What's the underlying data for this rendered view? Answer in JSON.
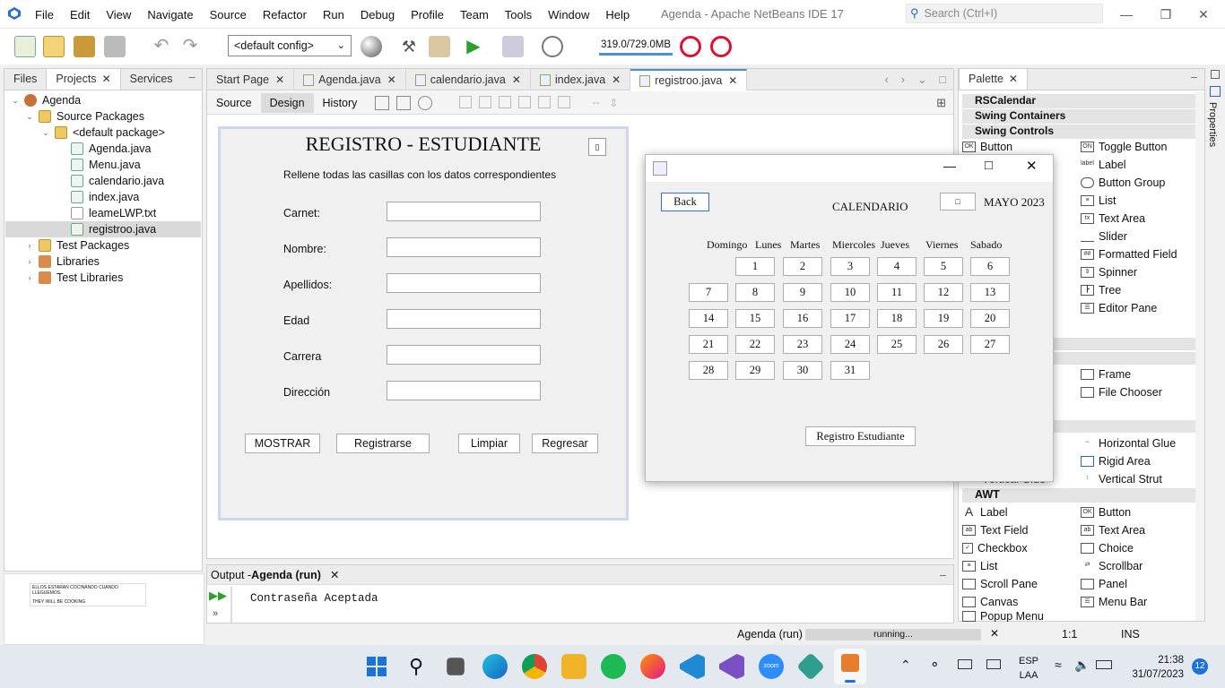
{
  "window": {
    "title": "Agenda - Apache NetBeans IDE 17"
  },
  "menu": [
    "File",
    "Edit",
    "View",
    "Navigate",
    "Source",
    "Refactor",
    "Run",
    "Debug",
    "Profile",
    "Team",
    "Tools",
    "Window",
    "Help"
  ],
  "search": {
    "placeholder": "Search (Ctrl+I)"
  },
  "toolbar": {
    "config": "<default config>",
    "memory": "319.0/729.0MB"
  },
  "left_panel": {
    "tabs": [
      {
        "label": "Files"
      },
      {
        "label": "Projects"
      },
      {
        "label": "Services"
      }
    ],
    "tree": [
      {
        "label": "Agenda"
      },
      {
        "label": "Source Packages"
      },
      {
        "label": "<default package>"
      },
      {
        "label": "Agenda.java"
      },
      {
        "label": "Menu.java"
      },
      {
        "label": "calendario.java"
      },
      {
        "label": "index.java"
      },
      {
        "label": "leameLWP.txt"
      },
      {
        "label": "registroo.java"
      },
      {
        "label": "Test Packages"
      },
      {
        "label": "Libraries"
      },
      {
        "label": "Test Libraries"
      }
    ]
  },
  "thumbnail": {
    "line1": "ELLOS ESTARAN COCINANDO CUANDO",
    "line2": "LLEGUEMOS.",
    "line3": "THEY WILL BE COOKING"
  },
  "editor": {
    "tabs": [
      {
        "label": "Start Page"
      },
      {
        "label": "Agenda.java"
      },
      {
        "label": "calendario.java"
      },
      {
        "label": "index.java"
      },
      {
        "label": "registroo.java"
      }
    ],
    "views": [
      "Source",
      "Design",
      "History"
    ]
  },
  "form": {
    "title": "REGISTRO - ESTUDIANTE",
    "subtitle": "Rellene todas las casillas con los datos correspondientes",
    "fields": [
      {
        "label": "Carnet:"
      },
      {
        "label": "Nombre:"
      },
      {
        "label": "Apellidos:"
      },
      {
        "label": "Edad"
      },
      {
        "label": "Carrera"
      },
      {
        "label": "Dirección"
      }
    ],
    "buttons": {
      "show": "MOSTRAR",
      "register": "Registrarse",
      "clear": "Limpiar",
      "back": "Regresar"
    }
  },
  "calendar": {
    "back": "Back",
    "title": "CALENDARIO",
    "month": "MAYO",
    "year": "2023",
    "daynames": [
      "Domingo",
      "Lunes",
      "Martes",
      "Miercoles",
      "Jueves",
      "Viernes",
      "Sabado"
    ],
    "start_offset": 1,
    "days": [
      "1",
      "2",
      "3",
      "4",
      "5",
      "6",
      "7",
      "8",
      "9",
      "10",
      "11",
      "12",
      "13",
      "14",
      "15",
      "16",
      "17",
      "18",
      "19",
      "20",
      "21",
      "22",
      "23",
      "24",
      "25",
      "26",
      "27",
      "28",
      "29",
      "30",
      "31"
    ],
    "register": "Registro Estudiante"
  },
  "palette": {
    "title": "Palette",
    "categories": {
      "rscalendar": "RSCalendar",
      "containers": "Swing Containers",
      "controls": "Swing Controls",
      "awt": "AWT"
    },
    "swing_left": [
      "Button"
    ],
    "swing_right": [
      "Toggle Button",
      "Label",
      "Button Group",
      "List",
      "Text Area",
      "Slider",
      "Formatted Field",
      "Spinner",
      "Tree",
      "Editor Pane"
    ],
    "windows_right": [
      "Frame",
      "File Chooser"
    ],
    "filler_right": [
      "Horizontal Glue",
      "Rigid Area",
      "Vertical Strut"
    ],
    "filler_left_partial": "Vertical Glue",
    "awt_left": [
      "Label",
      "Text Field",
      "Checkbox",
      "List",
      "Scroll Pane",
      "Canvas",
      "Popup Menu"
    ],
    "awt_right": [
      "Button",
      "Text Area",
      "Choice",
      "Scrollbar",
      "Panel",
      "Menu Bar"
    ]
  },
  "properties_tab": "Properties",
  "output": {
    "title": "Output - ",
    "title_bold": "Agenda (run)",
    "text": "Contraseña Aceptada"
  },
  "status": {
    "task": "Agenda (run)",
    "progress": "running...",
    "position": "1:1",
    "mode": "INS"
  },
  "taskbar": {
    "lang1": "ESP",
    "lang2": "LAA",
    "time": "21:38",
    "date": "31/07/2023",
    "badge": "12"
  }
}
